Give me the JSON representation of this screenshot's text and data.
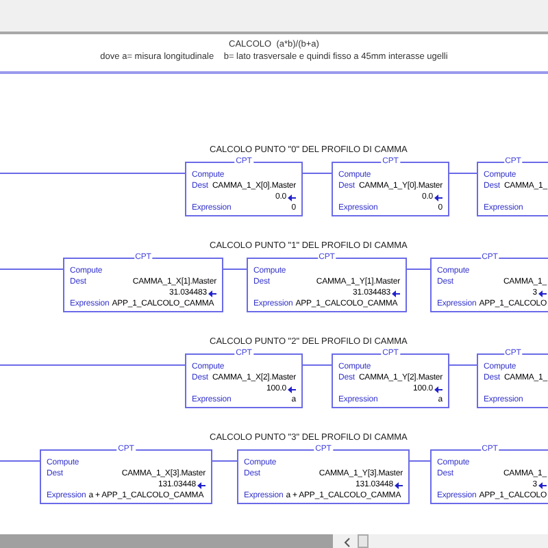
{
  "header": {
    "title": "CALCOLO  (a*b)/(b+a)",
    "note": "dove a= misura longitudinale    b= lato trasversale e quindi fisso a 45mm interasse ugelli"
  },
  "rungs": [
    {
      "title": "CALCOLO PUNTO \"0\" DEL PROFILO DI CAMMA",
      "blocks": [
        {
          "type": "CPT",
          "compute": "Compute",
          "dest_label": "Dest",
          "dest": "CAMMA_1_X[0].Master",
          "value": "0.0",
          "expression_label": "Expression",
          "expression": "0"
        },
        {
          "type": "CPT",
          "compute": "Compute",
          "dest_label": "Dest",
          "dest": "CAMMA_1_Y[0].Master",
          "value": "0.0",
          "expression_label": "Expression",
          "expression": "0"
        },
        {
          "type": "CPT",
          "compute": "Compute",
          "dest_label": "Dest",
          "dest": "CAMMA_1_",
          "expression_label": "Expression"
        }
      ]
    },
    {
      "title": "CALCOLO PUNTO \"1\" DEL PROFILO DI CAMMA",
      "blocks": [
        {
          "type": "CPT",
          "compute": "Compute",
          "dest_label": "Dest",
          "dest": "CAMMA_1_X[1].Master",
          "value": "31.034483",
          "expression_label": "Expression",
          "expression": "APP_1_CALCOLO_CAMMA"
        },
        {
          "type": "CPT",
          "compute": "Compute",
          "dest_label": "Dest",
          "dest": "CAMMA_1_Y[1].Master",
          "value": "31.034483",
          "expression_label": "Expression",
          "expression": "APP_1_CALCOLO_CAMMA"
        },
        {
          "type": "CPT",
          "compute": "Compute",
          "dest_label": "Dest",
          "dest": "CAMMA_1_",
          "value": "3",
          "expression_label": "Expression",
          "expression": "APP_1_CALCOLO"
        }
      ]
    },
    {
      "title": "CALCOLO PUNTO \"2\" DEL PROFILO DI CAMMA",
      "blocks": [
        {
          "type": "CPT",
          "compute": "Compute",
          "dest_label": "Dest",
          "dest": "CAMMA_1_X[2].Master",
          "value": "100.0",
          "expression_label": "Expression",
          "expression": "a"
        },
        {
          "type": "CPT",
          "compute": "Compute",
          "dest_label": "Dest",
          "dest": "CAMMA_1_Y[2].Master",
          "value": "100.0",
          "expression_label": "Expression",
          "expression": "a"
        },
        {
          "type": "CPT",
          "compute": "Compute",
          "dest_label": "Dest",
          "dest": "CAMMA_1_",
          "expression_label": "Expression"
        }
      ]
    },
    {
      "title": "CALCOLO PUNTO \"3\" DEL PROFILO DI CAMMA",
      "blocks": [
        {
          "type": "CPT",
          "compute": "Compute",
          "dest_label": "Dest",
          "dest": "CAMMA_1_X[3].Master",
          "value": "131.03448",
          "expression_label": "Expression",
          "expression": "a + APP_1_CALCOLO_CAMMA"
        },
        {
          "type": "CPT",
          "compute": "Compute",
          "dest_label": "Dest",
          "dest": "CAMMA_1_Y[3].Master",
          "value": "131.03448",
          "expression_label": "Expression",
          "expression": "a + APP_1_CALCOLO_CAMMA"
        },
        {
          "type": "CPT",
          "compute": "Compute",
          "dest_label": "Dest",
          "dest": "CAMMA_1_",
          "value": "3",
          "expression_label": "Expression",
          "expression": "APP_1_CALCOLO"
        }
      ]
    }
  ]
}
